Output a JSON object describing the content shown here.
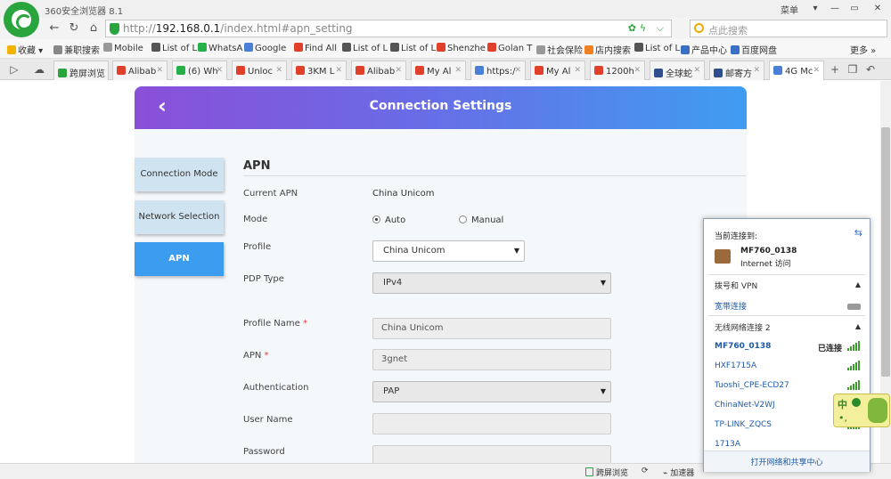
{
  "browser": {
    "title": "360安全浏览器 8.1",
    "menu_label": "菜单",
    "url_prefix": "http://",
    "url_host": "192.168.0.1",
    "url_path": "/index.html#apn_setting",
    "search_placeholder": "点此搜索",
    "colors": {
      "brand": "#2aa43c"
    }
  },
  "bookmarks": [
    {
      "label": "收藏",
      "color": "#f2b400"
    },
    {
      "label": "兼职搜索",
      "color": "#888888"
    },
    {
      "label": "Mobile",
      "color": "#999999"
    },
    {
      "label": "List of L",
      "color": "#555555"
    },
    {
      "label": "WhatsA",
      "color": "#25b04a"
    },
    {
      "label": "Google",
      "color": "#4a7fd8"
    },
    {
      "label": "Find All",
      "color": "#e0402a"
    },
    {
      "label": "List of L",
      "color": "#555555"
    },
    {
      "label": "List of L",
      "color": "#555555"
    },
    {
      "label": "Shenzhe",
      "color": "#e0402a"
    },
    {
      "label": "Golan T",
      "color": "#e0402a"
    },
    {
      "label": "社会保险",
      "color": "#999999"
    },
    {
      "label": "店内搜索",
      "color": "#f08020"
    },
    {
      "label": "List of L",
      "color": "#555555"
    },
    {
      "label": "产品中心",
      "color": "#3a6fc8"
    },
    {
      "label": "百度网盘",
      "color": "#3a6fc8"
    },
    {
      "label": "更多",
      "color": ""
    }
  ],
  "tabs": [
    {
      "label": "跨屏浏览",
      "color": "#2aa43c",
      "active": false
    },
    {
      "label": "Alibab",
      "color": "#e0402a",
      "active": false
    },
    {
      "label": "(6) Wh",
      "color": "#25b04a",
      "active": false
    },
    {
      "label": "Unloc",
      "color": "#e0402a",
      "active": false
    },
    {
      "label": "3KM L",
      "color": "#e0402a",
      "active": false
    },
    {
      "label": "Alibab",
      "color": "#e0402a",
      "active": false
    },
    {
      "label": "My Al",
      "color": "#e0402a",
      "active": false
    },
    {
      "label": "https:/",
      "color": "#4a7fd8",
      "active": false
    },
    {
      "label": "My Al",
      "color": "#e0402a",
      "active": false
    },
    {
      "label": "1200h",
      "color": "#e0402a",
      "active": false
    },
    {
      "label": "全球蛇",
      "color": "#2f4f8f",
      "active": false
    },
    {
      "label": "邮寄方",
      "color": "#2f4f8f",
      "active": false
    },
    {
      "label": "4G Mc",
      "color": "#4a7fd8",
      "active": true
    }
  ],
  "page": {
    "header_title": "Connection Settings",
    "menu": [
      {
        "label": "Connection Mode",
        "active": false
      },
      {
        "label": "Network Selection",
        "active": false
      },
      {
        "label": "APN",
        "active": true
      }
    ],
    "section_title": "APN",
    "current_apn": {
      "label": "Current APN",
      "value": "China Unicom"
    },
    "mode": {
      "label": "Mode",
      "option_auto": "Auto",
      "option_manual": "Manual",
      "selected": "Auto"
    },
    "profile": {
      "label": "Profile",
      "value": "China Unicom"
    },
    "pdp_type": {
      "label": "PDP Type",
      "value": "IPv4"
    },
    "profile_name": {
      "label": "Profile Name",
      "value": "China Unicom"
    },
    "apn": {
      "label": "APN",
      "value": "3gnet"
    },
    "authentication": {
      "label": "Authentication",
      "value": "PAP"
    },
    "user_name": {
      "label": "User Name",
      "value": ""
    },
    "password": {
      "label": "Password",
      "value": ""
    },
    "required_mark": "*",
    "colors": {
      "header_start": "#8a4fd8",
      "header_end": "#3f9df0",
      "active_menu": "#3b9cf0"
    }
  },
  "wifi_flyout": {
    "header": "当前连接到:",
    "current_network": "MF760_0138",
    "current_status": "Internet 访问",
    "dialup_section": "拨号和 VPN",
    "broadband": "宽带连接",
    "wireless_section": "无线网络连接 2",
    "networks": [
      {
        "name": "MF760_0138",
        "status": "已连接",
        "bold": true
      },
      {
        "name": "HXF1715A",
        "status": "",
        "bold": false
      },
      {
        "name": "Tuoshi_CPE-ECD27",
        "status": "",
        "bold": false
      },
      {
        "name": "ChinaNet-V2WJ",
        "status": "",
        "bold": false
      },
      {
        "name": "TP-LINK_ZQCS",
        "status": "",
        "bold": false
      },
      {
        "name": "1713A",
        "status": "",
        "bold": false
      }
    ],
    "footer_link": "打开网络和共享中心"
  },
  "ime": {
    "char": "中"
  },
  "statusbar": {
    "cross_screen": "跨屏浏览",
    "accelerator": "加速器"
  }
}
